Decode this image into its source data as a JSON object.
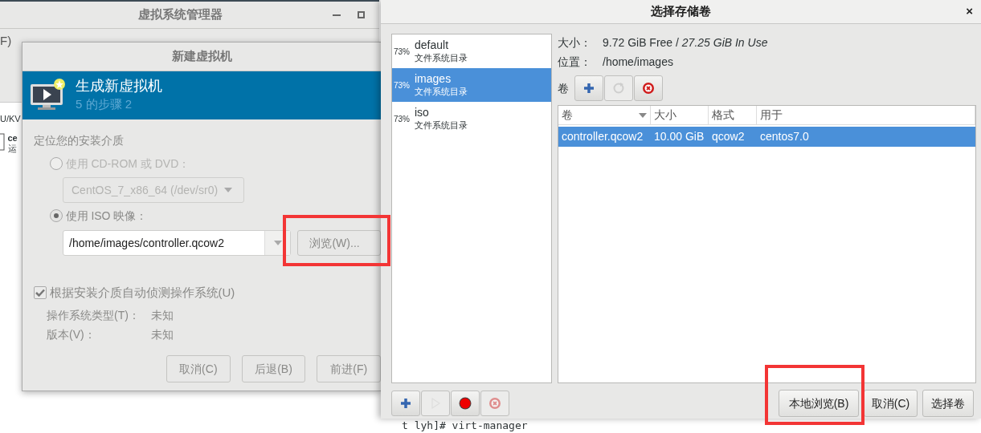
{
  "manager_window": {
    "title": "虚拟系统管理器",
    "menu": [
      "F)"
    ],
    "connection": "U/KV",
    "vm": {
      "name": "ce",
      "status": "运"
    }
  },
  "new_vm_dialog": {
    "title": "新建虚拟机",
    "header": {
      "title": "生成新虚拟机",
      "step": "5 的步骤 2"
    },
    "section": "定位您的安装介质",
    "sources": [
      {
        "label": "使用 CD-ROM 或 DVD：",
        "selected": false,
        "disabled": true,
        "kind": "dropdown",
        "value": "CentOS_7_x86_64 (/dev/sr0)"
      },
      {
        "label": "使用 ISO 映像：",
        "selected": true,
        "disabled": false,
        "kind": "combo",
        "value": "/home/images/controller.qcow2",
        "button": "浏览(W)..."
      }
    ],
    "autodetect": {
      "label": "根据安装介质自动侦测操作系统(U)",
      "checked": true
    },
    "os_info": [
      {
        "label": "操作系统类型(T)：",
        "value": "未知"
      },
      {
        "label": "版本(V)：",
        "value": "未知"
      }
    ],
    "buttons": [
      "取消(C)",
      "后退(B)",
      "前进(F)"
    ]
  },
  "storage_dialog": {
    "title": "选择存储卷",
    "close": "×",
    "pools": [
      {
        "usage": "73%",
        "name": "default",
        "type": "文件系统目录",
        "selected": false
      },
      {
        "usage": "73%",
        "name": "images",
        "type": "文件系统目录",
        "selected": true
      },
      {
        "usage": "73%",
        "name": "iso",
        "type": "文件系统目录",
        "selected": false
      }
    ],
    "size_label": "大小：",
    "size_value": "9.72 GiB Free / *27.25 GiB In Use*",
    "location_label": "位置：",
    "location": "/home/images",
    "volumes_label": "卷",
    "volume_tools": [
      {
        "kind": "add",
        "disabled": false
      },
      {
        "kind": "refresh",
        "disabled": true
      },
      {
        "kind": "delete",
        "disabled": false
      }
    ],
    "volume_columns": [
      "卷",
      "大小",
      "格式",
      "用于"
    ],
    "volumes": [
      {
        "cells": [
          "controller.qcow2",
          "10.00 GiB",
          "qcow2",
          "centos7.0"
        ],
        "selected": true
      }
    ],
    "pool_tools": [
      {
        "kind": "add",
        "disabled": false
      },
      {
        "kind": "start",
        "disabled": true
      },
      {
        "kind": "stop",
        "disabled": false
      },
      {
        "kind": "delete",
        "disabled": true
      }
    ],
    "buttons": [
      "本地浏览(B)",
      "取消(C)",
      "选择卷"
    ]
  },
  "terminal_text": "t lyh]# virt-manager"
}
